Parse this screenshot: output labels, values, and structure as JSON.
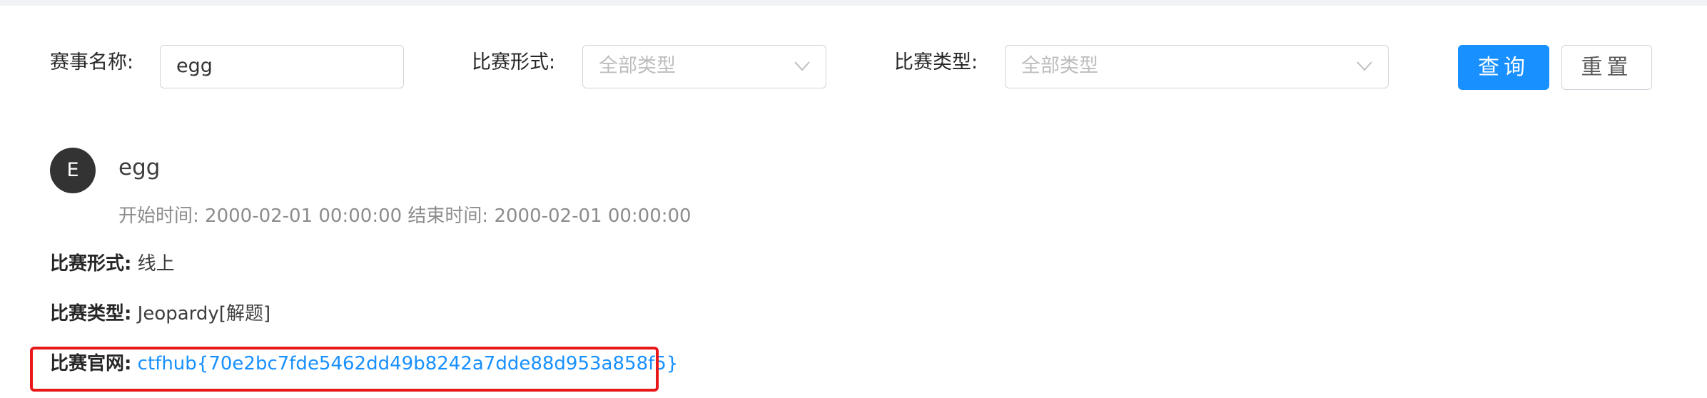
{
  "filters": {
    "name_label": "赛事名称:",
    "name_value": "egg",
    "format_label": "比赛形式:",
    "format_placeholder": "全部类型",
    "type_label": "比赛类型:",
    "type_placeholder": "全部类型",
    "query_button": "查询",
    "reset_button": "重置"
  },
  "event": {
    "avatar_letter": "E",
    "name": "egg",
    "time_text": "开始时间: 2000-02-01 00:00:00 结束时间: 2000-02-01 00:00:00",
    "format_label": "比赛形式:",
    "format_value": "线上",
    "type_label": "比赛类型:",
    "type_value": "Jeopardy[解题]",
    "site_label": "比赛官网:",
    "site_value": "ctfhub{70e2bc7fde5462dd49b8242a7dde88d953a858f5}"
  },
  "colors": {
    "primary": "#1890ff",
    "highlight_border": "#e8181a",
    "avatar_bg": "#333333"
  }
}
